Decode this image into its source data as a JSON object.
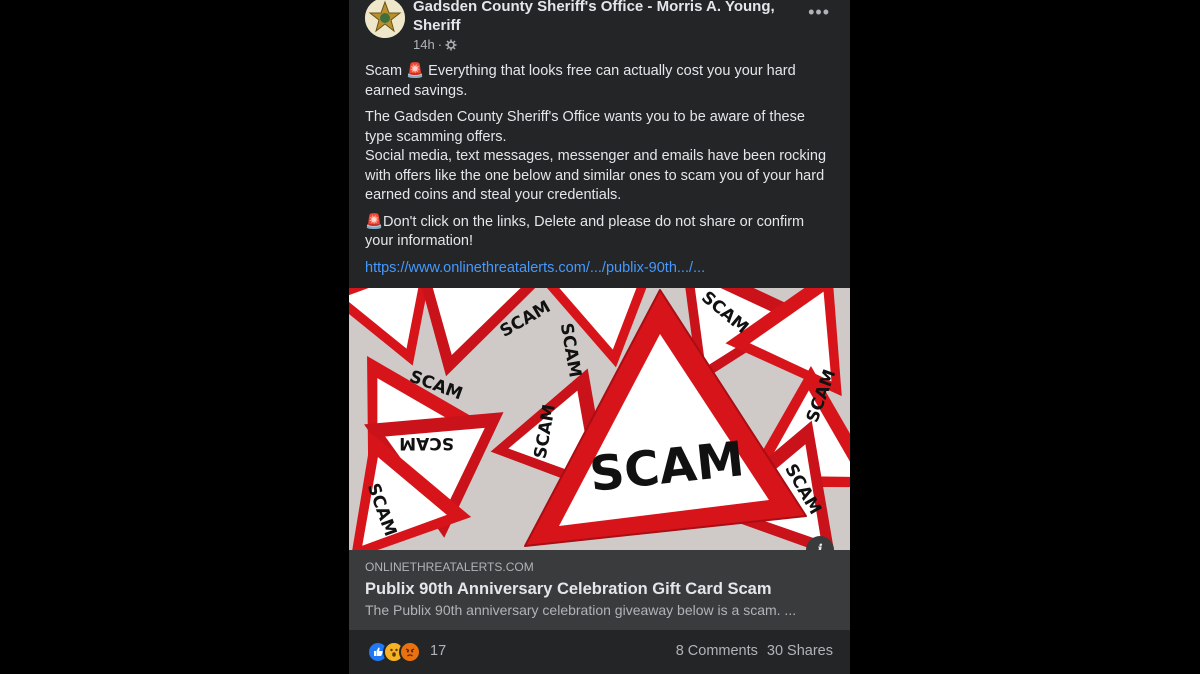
{
  "post": {
    "page_name": "Gadsden County Sheriff's Office - Morris A. Young, Sheriff",
    "time": "14h",
    "audience_icon": "gear-globe-icon",
    "more_icon": "•••",
    "paragraph_1": "Scam 🚨 Everything that looks free can actually cost you your hard earned savings.",
    "paragraph_2_line_1": "The Gadsden County Sheriff's Office wants you to be aware of these type scamming offers.",
    "paragraph_2_line_2": "Social media, text messages, messenger and emails have been rocking with offers like the one below and similar ones to scam you of your hard earned coins and steal your credentials.",
    "paragraph_3": "🚨Don't click on the links, Delete and please do not share or confirm your information!",
    "link_text": "https://www.onlinethreatalerts.com/.../publix-90th.../..."
  },
  "image": {
    "main_sign_text": "SCAM",
    "small_sign_text": "SCAM",
    "colors": {
      "red": "#d7141a",
      "white": "#ffffff"
    }
  },
  "link_preview": {
    "domain": "ONLINETHREATALERTS.COM",
    "title": "Publix 90th Anniversary Celebration Gift Card Scam",
    "description": "The Publix 90th anniversary celebration giveaway below is a scam. ...",
    "info_icon": "i"
  },
  "footer": {
    "reaction_icons": [
      "like-icon",
      "wow-icon",
      "angry-icon"
    ],
    "reaction_count": "17",
    "comments": "8 Comments",
    "shares": "30 Shares"
  }
}
